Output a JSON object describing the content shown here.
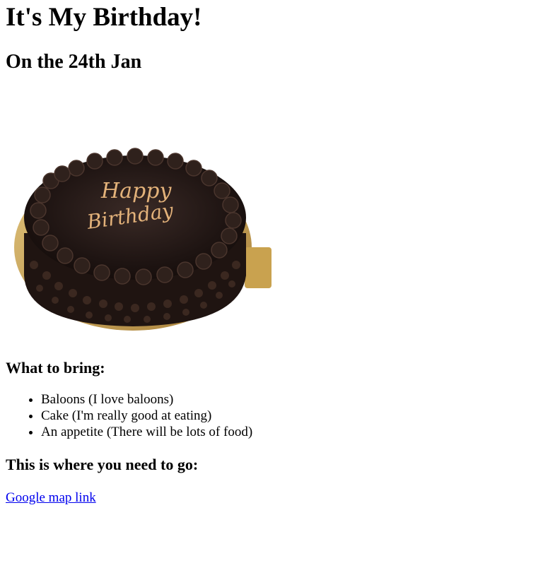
{
  "page": {
    "title": "It's My Birthday!",
    "date_heading": "On the 24th Jan"
  },
  "cake_image": {
    "inscription_line1": "Happy",
    "inscription_line2": "Birthday"
  },
  "bring": {
    "heading": "What to bring:",
    "items": [
      "Baloons (I love baloons)",
      "Cake (I'm really good at eating)",
      "An appetite (There will be lots of food)"
    ]
  },
  "location": {
    "heading": "This is where you need to go:",
    "link_text": "Google map link"
  },
  "colors": {
    "link": "#0000ee",
    "chocolate": "#2a1a14",
    "board": "#c9a24f",
    "inscription": "#e3b27a"
  }
}
